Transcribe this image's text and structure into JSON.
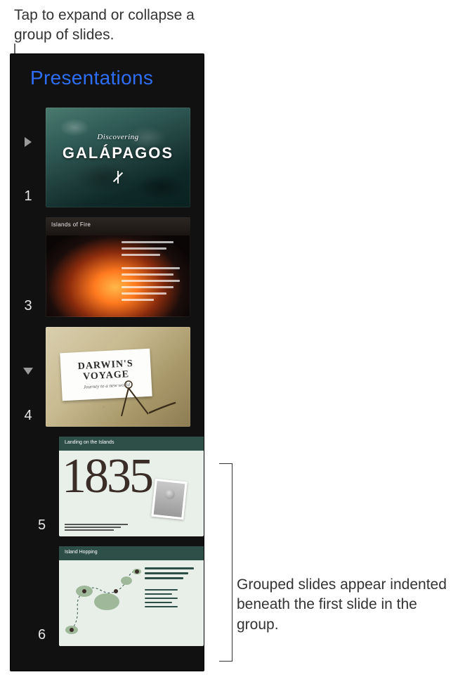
{
  "callouts": {
    "top": "Tap to expand or collapse a group of slides.",
    "right": "Grouped slides appear indented beneath the first slide in the group."
  },
  "panel": {
    "title": "Presentations"
  },
  "slides": [
    {
      "number": "1",
      "indent": 0,
      "disclosure": "collapsed",
      "content": {
        "overline": "Discovering",
        "title": "GALÁPAGOS"
      }
    },
    {
      "number": "3",
      "indent": 0,
      "disclosure": "none",
      "content": {
        "heading": "Islands of Fire"
      }
    },
    {
      "number": "4",
      "indent": 0,
      "disclosure": "expanded",
      "content": {
        "title_line1": "DARWIN'S",
        "title_line2": "VOYAGE",
        "subtitle": "Journey to a new world"
      }
    },
    {
      "number": "5",
      "indent": 1,
      "disclosure": "none",
      "content": {
        "heading": "Landing on the Islands",
        "year": "1835"
      }
    },
    {
      "number": "6",
      "indent": 1,
      "disclosure": "none",
      "content": {
        "heading": "Island Hopping"
      }
    }
  ]
}
